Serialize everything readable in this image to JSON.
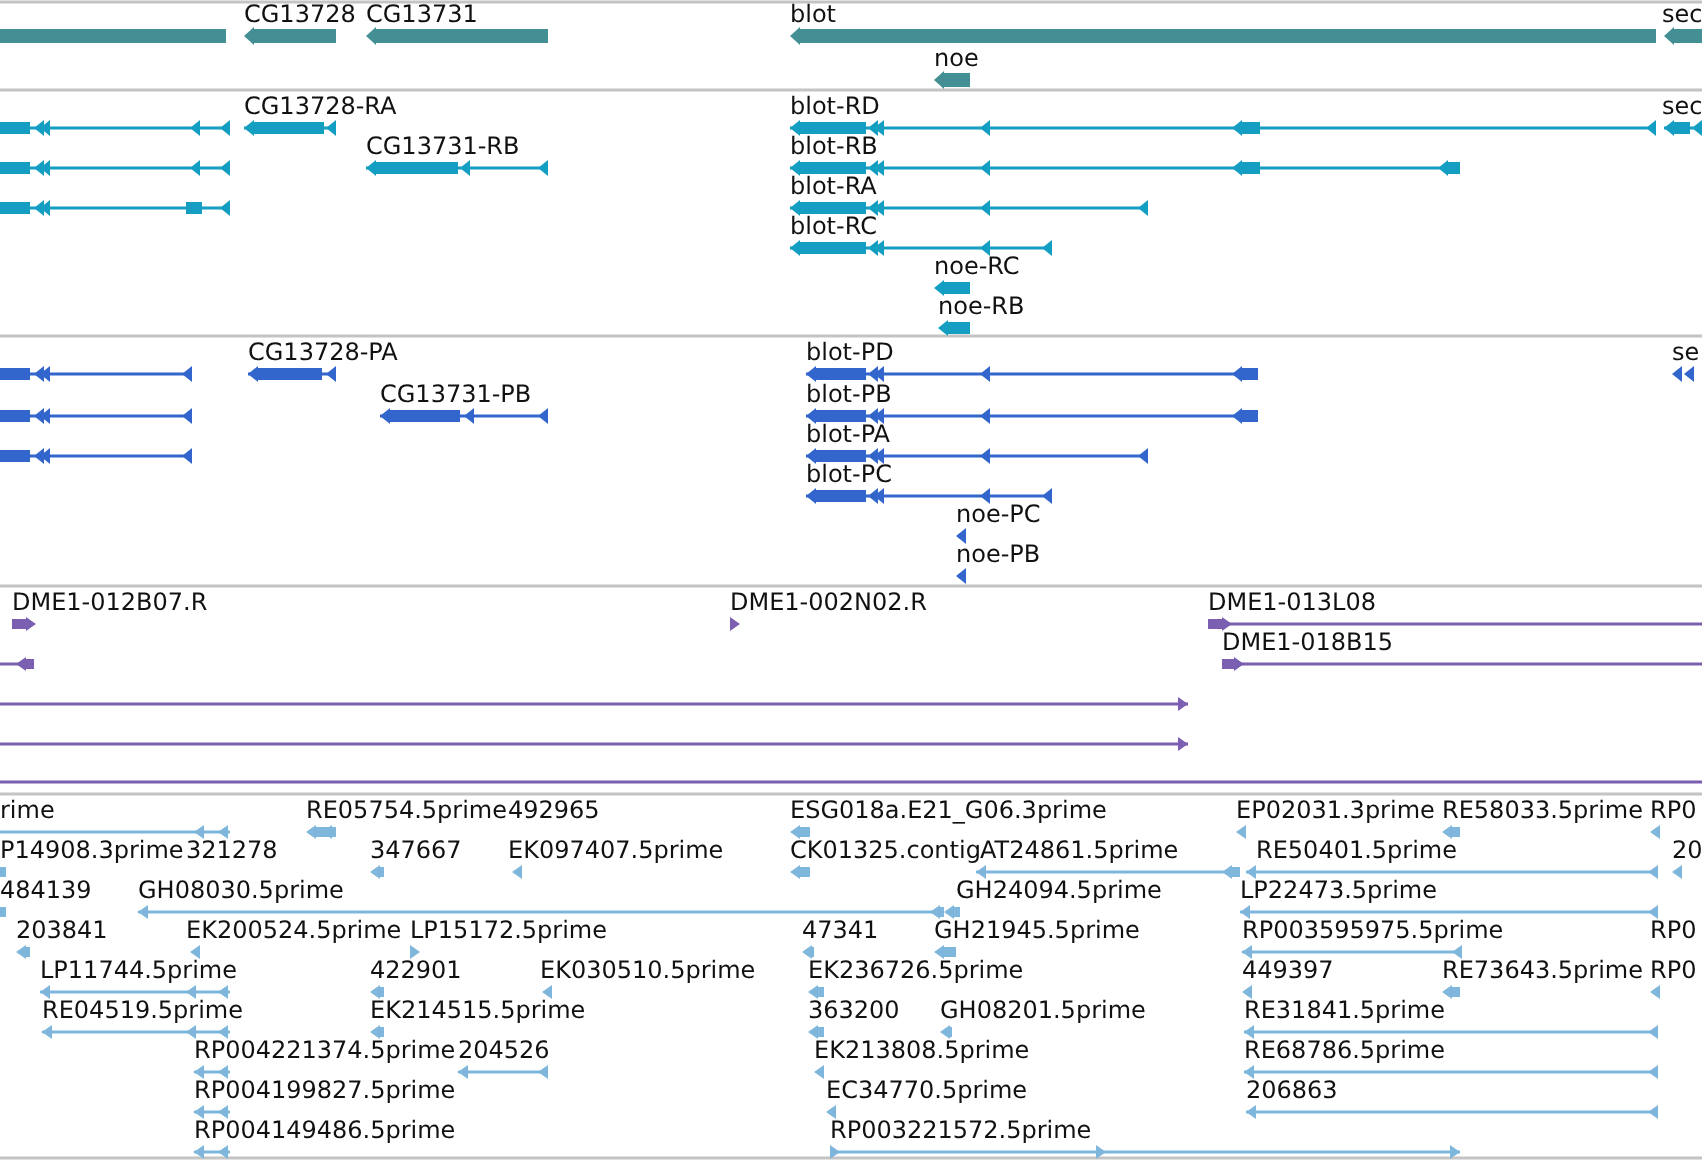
{
  "tracks": [
    {
      "kind": "gene",
      "features": [
        {
          "label": "CG13728"
        },
        {
          "label": "CG13731"
        },
        {
          "label": "blot"
        },
        {
          "label": "sec"
        },
        {
          "label": "noe"
        }
      ]
    },
    {
      "kind": "transcript",
      "features": [
        {
          "label": "CG13728-RA"
        },
        {
          "label": "CG13731-RB"
        },
        {
          "label": "blot-RD"
        },
        {
          "label": "blot-RB"
        },
        {
          "label": "blot-RA"
        },
        {
          "label": "blot-RC"
        },
        {
          "label": "noe-RC"
        },
        {
          "label": "noe-RB"
        },
        {
          "label": "sec"
        }
      ]
    },
    {
      "kind": "protein",
      "features": [
        {
          "label": "CG13728-PA"
        },
        {
          "label": "CG13731-PB"
        },
        {
          "label": "blot-PD"
        },
        {
          "label": "blot-PB"
        },
        {
          "label": "blot-PA"
        },
        {
          "label": "blot-PC"
        },
        {
          "label": "se"
        },
        {
          "label": "noe-PC"
        },
        {
          "label": "noe-PB"
        }
      ]
    },
    {
      "kind": "clone",
      "features": [
        {
          "label": "DME1-012B07.R"
        },
        {
          "label": "DME1-002N02.R"
        },
        {
          "label": "DME1-013L08"
        },
        {
          "label": "DME1-018B15"
        }
      ]
    },
    {
      "kind": "est",
      "features": [
        {
          "label": "rime"
        },
        {
          "label": "RE05754.5prime"
        },
        {
          "label": "492965"
        },
        {
          "label": "ESG018a.E21_G06.3prime"
        },
        {
          "label": "EP02031.3prime"
        },
        {
          "label": "RE58033.5prime"
        },
        {
          "label": "RP0"
        },
        {
          "label": "P14908.3prime"
        },
        {
          "label": "321278"
        },
        {
          "label": "347667"
        },
        {
          "label": "EK097407.5prime"
        },
        {
          "label": "CK01325.contig"
        },
        {
          "label": "AT24861.5prime"
        },
        {
          "label": "RE50401.5prime"
        },
        {
          "label": "20"
        },
        {
          "label": "484139"
        },
        {
          "label": "GH08030.5prime"
        },
        {
          "label": "GH24094.5prime"
        },
        {
          "label": "LP22473.5prime"
        },
        {
          "label": "203841"
        },
        {
          "label": "EK200524.5prime"
        },
        {
          "label": "LP15172.5prime"
        },
        {
          "label": "47341"
        },
        {
          "label": "GH21945.5prime"
        },
        {
          "label": "RP003595975.5prime"
        },
        {
          "label": "RP0"
        },
        {
          "label": "LP11744.5prime"
        },
        {
          "label": "422901"
        },
        {
          "label": "EK030510.5prime"
        },
        {
          "label": "EK236726.5prime"
        },
        {
          "label": "449397"
        },
        {
          "label": "RE73643.5prime"
        },
        {
          "label": "RP0"
        },
        {
          "label": "RE04519.5prime"
        },
        {
          "label": "EK214515.5prime"
        },
        {
          "label": "363200"
        },
        {
          "label": "GH08201.5prime"
        },
        {
          "label": "RE31841.5prime"
        },
        {
          "label": "RP004221374.5prime"
        },
        {
          "label": "204526"
        },
        {
          "label": "EK213808.5prime"
        },
        {
          "label": "RE68786.5prime"
        },
        {
          "label": "RP004199827.5prime"
        },
        {
          "label": "EC34770.5prime"
        },
        {
          "label": "206863"
        },
        {
          "label": "RP004149486.5prime"
        },
        {
          "label": "RP003221572.5prime"
        }
      ]
    }
  ]
}
